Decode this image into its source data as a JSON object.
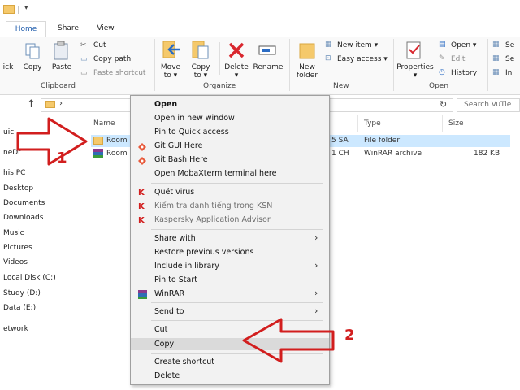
{
  "tabs": [
    "Home",
    "Share",
    "View"
  ],
  "clipboard": {
    "partial_button": "ick",
    "copy": "Copy",
    "paste": "Paste",
    "cut": "Cut",
    "copy_path": "Copy path",
    "paste_shortcut": "Paste shortcut",
    "label": "Clipboard"
  },
  "organize": {
    "move_to": [
      "Move",
      "to ▾"
    ],
    "copy_to": [
      "Copy",
      "to ▾"
    ],
    "delete": [
      "Delete",
      "▾"
    ],
    "rename": "Rename",
    "label": "Organize"
  },
  "new_group": {
    "new_folder": [
      "New",
      "folder"
    ],
    "new_item": "New item ▾",
    "easy_access": "Easy access ▾",
    "label": "New"
  },
  "open_group": {
    "properties": [
      "Properties",
      "▾"
    ],
    "open": "Open ▾",
    "edit": "Edit",
    "history": "History",
    "label": "Open"
  },
  "select_group": [
    "Se",
    "Se",
    "In"
  ],
  "address": {
    "chevron": "›",
    "search_placeholder": "Search VuTie"
  },
  "nav_pane": [
    "uic",
    "neDr",
    "his PC",
    "Desktop",
    "Documents",
    "Downloads",
    "Music",
    "Pictures",
    "Videos",
    "Local Disk (C:)",
    "Study (D:)",
    "Data (E:)",
    "etwork"
  ],
  "columns": [
    "Name",
    "Type",
    "Size"
  ],
  "files": [
    {
      "name": "Room",
      "date_partial": "5 SA",
      "type": "File folder",
      "size": ""
    },
    {
      "name": "Room",
      "date_partial": "1 CH",
      "type": "WinRAR archive",
      "size": "182 KB"
    }
  ],
  "context_menu": {
    "group1": [
      "Open",
      "Open in new window",
      "Pin to Quick access",
      "Git GUI Here",
      "Git Bash Here",
      "Open MobaXterm terminal here"
    ],
    "group2": [
      "Quét virus",
      "Kiểm tra danh tiếng trong KSN",
      "Kaspersky Application Advisor"
    ],
    "group3": [
      "Share with",
      "Restore previous versions",
      "Include in library",
      "Pin to Start",
      "WinRAR"
    ],
    "group4": [
      "Send to"
    ],
    "group5": [
      "Cut",
      "Copy"
    ],
    "group6": [
      "Create shortcut",
      "Delete"
    ]
  },
  "annotations": {
    "arrow1_number": "1",
    "arrow2_number": "2"
  },
  "colors": {
    "accent": "#1e5bab",
    "selection": "#cce8ff",
    "annotation_red": "#d21e1e",
    "folder": "#f5c96b"
  }
}
